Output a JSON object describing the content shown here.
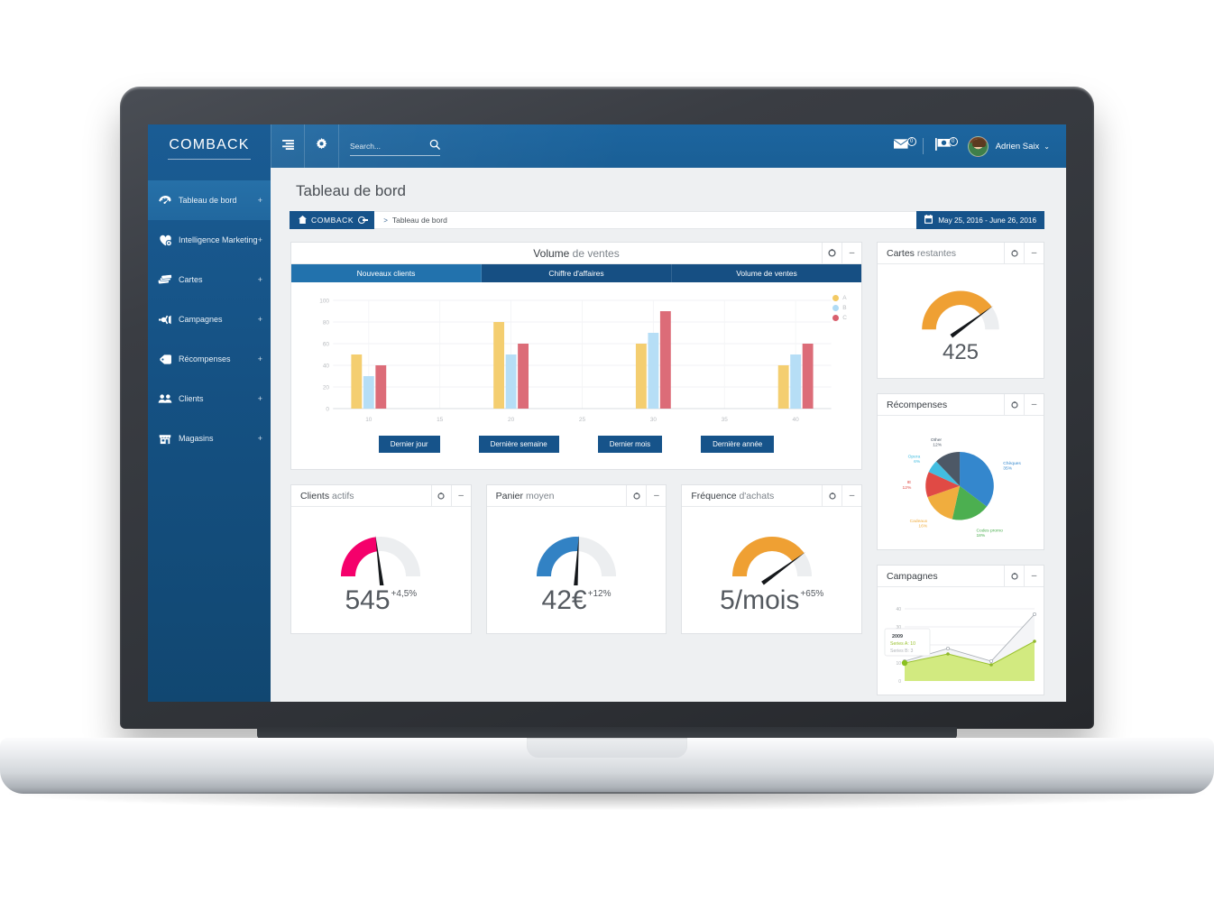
{
  "brand": {
    "name": "COMBACK",
    "accent": "#16538a",
    "topbar": "#1a5f96"
  },
  "topbar": {
    "menu_icon": "hamburger-list-icon",
    "settings_icon": "gear-icon",
    "search_placeholder": "Search...",
    "search_value": "",
    "search_icon": "search-icon",
    "mail_icon": "mail-icon",
    "mail_badge": "0",
    "flag_icon": "flag-icon",
    "flag_badge": "0",
    "user_name": "Adrien Saix",
    "caret_icon": "chevron-down-icon"
  },
  "sidebar": {
    "items": [
      {
        "label": "Tableau de bord",
        "icon": "dashboard-icon",
        "expand": "+",
        "active": true
      },
      {
        "label": "Intelligence Marketing",
        "icon": "heart-gear-icon",
        "expand": "+",
        "active": false
      },
      {
        "label": "Cartes",
        "icon": "cards-icon",
        "expand": "+",
        "active": false
      },
      {
        "label": "Campagnes",
        "icon": "megaphone-icon",
        "expand": "+",
        "active": false
      },
      {
        "label": "Récompenses",
        "icon": "tag-icon",
        "expand": "+",
        "active": false
      },
      {
        "label": "Clients",
        "icon": "users-icon",
        "expand": "+",
        "active": false
      },
      {
        "label": "Magasins",
        "icon": "store-icon",
        "expand": "+",
        "active": false
      }
    ]
  },
  "page": {
    "title": "Tableau de bord",
    "breadcrumb": {
      "home_label": "COMBACK",
      "home_icon": "home-icon",
      "separator": ">",
      "current": "Tableau de bord"
    },
    "date_range": {
      "label": "May 25, 2016 - June 26, 2016",
      "icon": "calendar-icon"
    }
  },
  "panels": {
    "sales": {
      "title_bold": "Volume",
      "title_light": " de ventes",
      "settings_icon": "gear-icon",
      "minimize_icon": "minus-icon",
      "tabs": [
        {
          "label": "Nouveaux clients",
          "active": true
        },
        {
          "label": "Chiffre d'affaires",
          "active": false
        },
        {
          "label": "Volume de ventes",
          "active": false
        }
      ],
      "range_buttons": [
        "Dernier jour",
        "Dernière semaine",
        "Dernier mois",
        "Dernière année"
      ]
    },
    "clients_actifs": {
      "title_bold": "Clients",
      "title_light": " actifs",
      "value": "545",
      "delta": "+4,5%",
      "gauge_pct": 46,
      "gauge_color": "#f5006b",
      "settings_icon": "gear-icon",
      "minimize_icon": "minus-icon"
    },
    "panier_moyen": {
      "title_bold": "Panier",
      "title_light": " moyen",
      "value": "42€",
      "delta": "+12%",
      "gauge_pct": 52,
      "gauge_color": "#3282c4",
      "settings_icon": "gear-icon",
      "minimize_icon": "minus-icon"
    },
    "frequence": {
      "title_bold": "Fréquence",
      "title_light": " d'achats",
      "value": "5/mois",
      "delta": "+65%",
      "gauge_pct": 80,
      "gauge_color": "#efa033",
      "settings_icon": "gear-icon",
      "minimize_icon": "minus-icon"
    },
    "cartes_restantes": {
      "title_bold": "Cartes",
      "title_light": " restantes",
      "value": "425",
      "gauge_pct": 80,
      "gauge_color": "#efa033",
      "settings_icon": "gear-icon",
      "minimize_icon": "minus-icon"
    },
    "recompenses": {
      "title_bold": "Récompenses",
      "title_light": "",
      "settings_icon": "gear-icon",
      "minimize_icon": "minus-icon"
    },
    "campagnes": {
      "title_bold": "Campagnes",
      "title_light": "",
      "settings_icon": "gear-icon",
      "minimize_icon": "minus-icon"
    }
  },
  "chart_data": [
    {
      "id": "sales-bar-chart",
      "type": "bar",
      "title": "Volume de ventes",
      "xlabel": "",
      "ylabel": "",
      "categories": [
        "10",
        "20",
        "30",
        "40"
      ],
      "xticks": [
        "10",
        "15",
        "20",
        "25",
        "30",
        "35",
        "40"
      ],
      "yticks": [
        0,
        20,
        40,
        60,
        80,
        100
      ],
      "ylim": [
        0,
        100
      ],
      "grid": true,
      "legend_position": "top-right",
      "series": [
        {
          "name": "A",
          "color": "#f3ca64",
          "values": [
            50,
            80,
            60,
            40
          ]
        },
        {
          "name": "B",
          "color": "#b0dbf5",
          "values": [
            30,
            50,
            70,
            50
          ]
        },
        {
          "name": "C",
          "color": "#d9606d",
          "values": [
            40,
            60,
            90,
            60
          ]
        }
      ]
    },
    {
      "id": "recompenses-pie-chart",
      "type": "pie",
      "title": "Récompenses",
      "labels": [
        "Chèques",
        "Codes promo",
        "Cadeaux",
        "IE",
        "Opera",
        "Other"
      ],
      "values": [
        35,
        18,
        16,
        12,
        6,
        12
      ],
      "value_labels": [
        "35%",
        "18%",
        "16%",
        "12%",
        "6%",
        "12%"
      ],
      "colors": [
        "#3487cd",
        "#4caf50",
        "#f0ad3e",
        "#e04a45",
        "#42bde0",
        "#4d5866"
      ],
      "legend_position": "around-slices"
    },
    {
      "id": "campagnes-area-chart",
      "type": "area",
      "title": "Campagnes",
      "yticks": [
        0,
        10,
        20,
        30,
        40
      ],
      "ylim": [
        0,
        45
      ],
      "grid": true,
      "tooltip": {
        "x": "2009",
        "rows": [
          "Series A: 10",
          "Series B: 3"
        ]
      },
      "series": [
        {
          "name": "Series A",
          "color": "#c3e05a",
          "values": [
            10,
            15,
            9,
            22
          ]
        },
        {
          "name": "Series B",
          "color": "#aab0b6",
          "values": [
            11,
            18,
            11,
            37
          ]
        }
      ]
    }
  ]
}
